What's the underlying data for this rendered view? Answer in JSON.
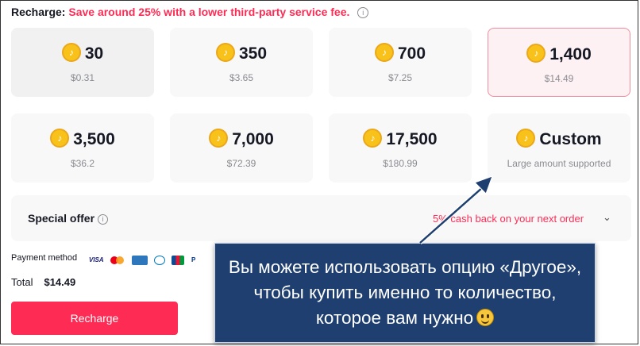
{
  "header": {
    "label": "Recharge:",
    "promo": "Save around 25% with a lower third-party service fee.",
    "info_icon": "info-icon"
  },
  "packages": [
    {
      "coins": "30",
      "price": "$0.31"
    },
    {
      "coins": "350",
      "price": "$3.65"
    },
    {
      "coins": "700",
      "price": "$7.25"
    },
    {
      "coins": "1,400",
      "price": "$14.49",
      "selected": true
    },
    {
      "coins": "3,500",
      "price": "$36.2"
    },
    {
      "coins": "7,000",
      "price": "$72.39"
    },
    {
      "coins": "17,500",
      "price": "$180.99"
    },
    {
      "coins": "Custom",
      "price": "Large amount supported"
    }
  ],
  "special_offer": {
    "label": "Special offer",
    "cashback": "5% cash back on your next order"
  },
  "payment": {
    "label": "Payment method",
    "methods": [
      "VISA",
      "mastercard",
      "amex",
      "diners",
      "jcb",
      "paypal"
    ]
  },
  "total": {
    "label": "Total",
    "amount": "$14.49"
  },
  "recharge_button": "Recharge",
  "callout": {
    "text": "Вы можете использовать опцию «Другое», чтобы купить именно то количество, которое вам нужно"
  },
  "colors": {
    "accent": "#fe2c55",
    "callout_bg": "#1e3f6f",
    "coin": "#f9c21a"
  }
}
